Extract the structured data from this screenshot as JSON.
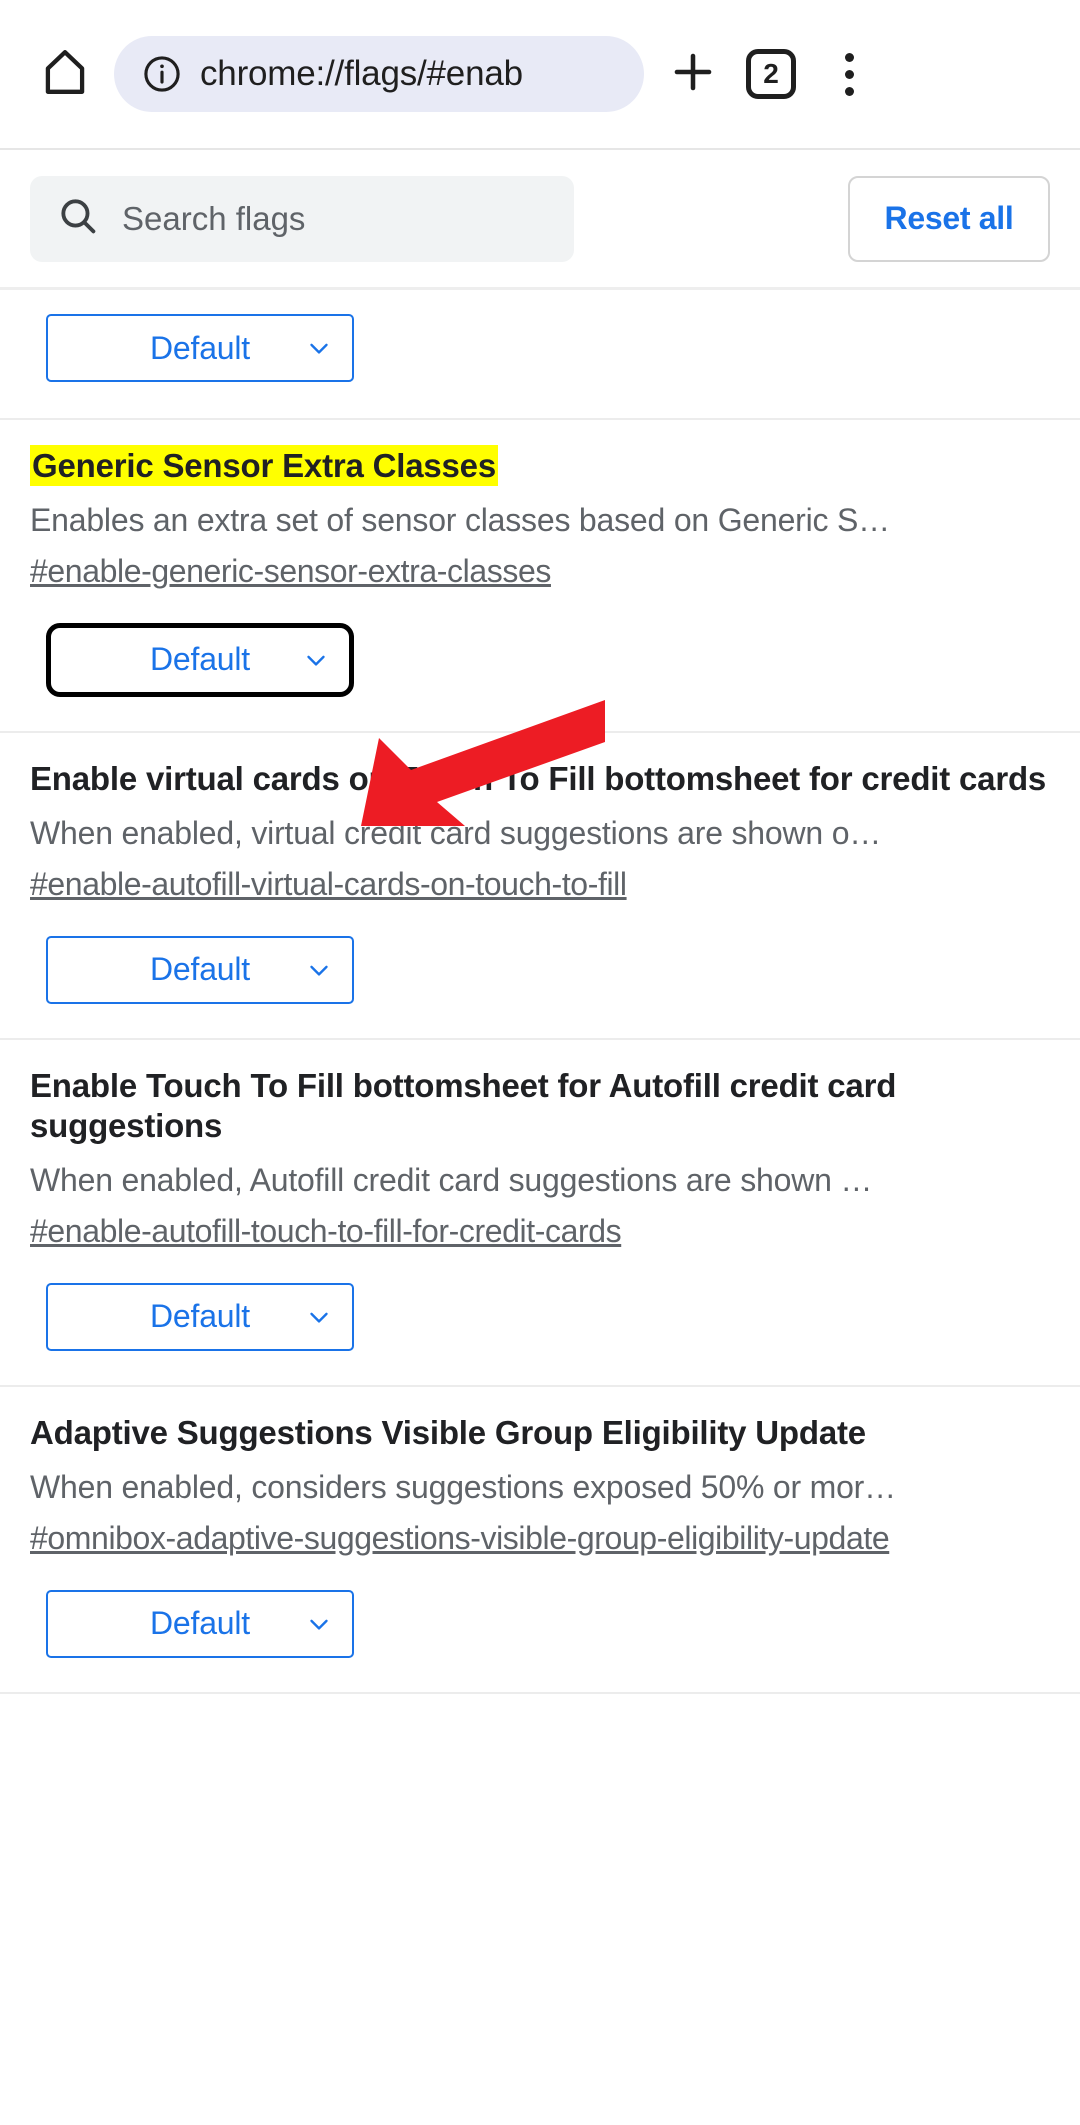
{
  "browser": {
    "home_icon": "home-icon",
    "info_icon": "info-icon",
    "url": "chrome://flags/#enab",
    "new_tab_label": "+",
    "tab_count": "2",
    "menu_icon": "more-vertical-icon"
  },
  "search": {
    "icon": "search-icon",
    "placeholder": "Search flags",
    "value": "",
    "reset_label": "Reset all"
  },
  "colors": {
    "link_blue": "#1a73e8",
    "highlight_yellow": "#ffff00",
    "arrow_red": "#ed1c24",
    "body_text": "#202124",
    "muted_text": "#5f6368"
  },
  "flags": [
    {
      "id": "partial-top",
      "title": "",
      "description": "",
      "link": "",
      "select_value": "Default",
      "focused": false,
      "highlighted": false,
      "partial": true
    },
    {
      "id": "generic-sensor-extra-classes",
      "title": "Generic Sensor Extra Classes",
      "description": "Enables an extra set of sensor classes based on Generic S…",
      "link": "#enable-generic-sensor-extra-classes",
      "select_value": "Default",
      "focused": true,
      "highlighted": true,
      "partial": false
    },
    {
      "id": "enable-autofill-virtual-cards-on-touch-to-fill",
      "title": "Enable virtual cards on Touch To Fill bottomsheet for credit cards",
      "description": "When enabled, virtual credit card suggestions are shown o…",
      "link": "#enable-autofill-virtual-cards-on-touch-to-fill",
      "select_value": "Default",
      "focused": false,
      "highlighted": false,
      "partial": false
    },
    {
      "id": "enable-autofill-touch-to-fill-for-credit-cards",
      "title": "Enable Touch To Fill bottomsheet for Autofill credit card suggestions",
      "description": "When enabled, Autofill credit card suggestions are shown …",
      "link": "#enable-autofill-touch-to-fill-for-credit-cards",
      "select_value": "Default",
      "focused": false,
      "highlighted": false,
      "partial": false
    },
    {
      "id": "omnibox-adaptive-suggestions-visible-group-eligibility-update",
      "title": "Adaptive Suggestions Visible Group Eligibility Update",
      "description": "When enabled, considers suggestions exposed 50% or mor…",
      "link": "#omnibox-adaptive-suggestions-visible-group-eligibility-update",
      "select_value": "Default",
      "focused": false,
      "highlighted": false,
      "partial": false
    }
  ],
  "annotation": {
    "type": "arrow",
    "direction": "down-left",
    "target": "generic-sensor-extra-classes select"
  }
}
